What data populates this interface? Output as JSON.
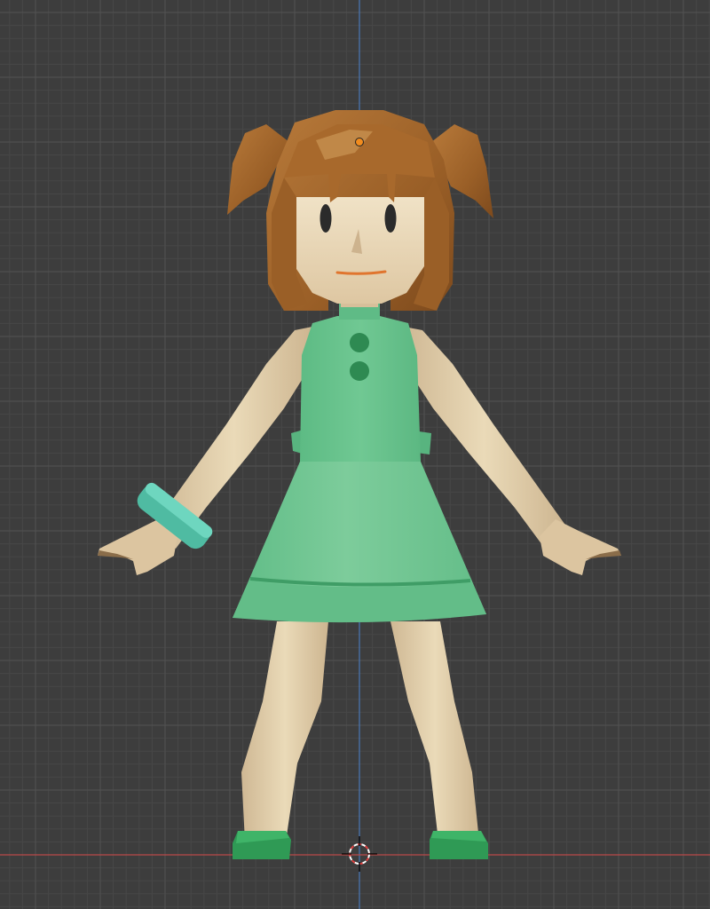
{
  "viewport": {
    "background": "#3d3d3d",
    "grid_minor_color": "#474747",
    "grid_major_color": "#525252",
    "x_axis_color": "#c0504d",
    "z_axis_color": "#4a78b8"
  },
  "scene": {
    "object": "character-model",
    "skin_color": "#e3cfad",
    "hair_color": "#a8692c",
    "dress_color": "#6cc490",
    "bracelet_color": "#5ec9b1",
    "shoe_color": "#2f9a55",
    "origin_marker_color": "#f28c1e",
    "cursor_icon": "3d-cursor-icon"
  }
}
